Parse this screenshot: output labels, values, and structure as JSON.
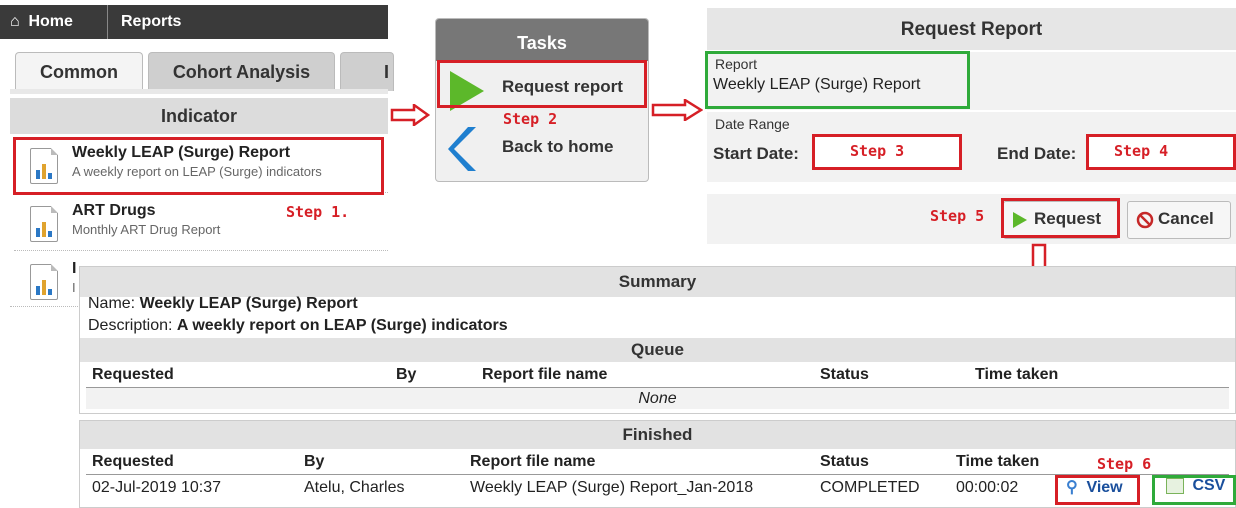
{
  "nav": {
    "home": "Home",
    "reports": "Reports"
  },
  "tabs": [
    "Common",
    "Cohort Analysis",
    "I"
  ],
  "indicator": {
    "header": "Indicator",
    "items": [
      {
        "title": "Weekly LEAP (Surge) Report",
        "desc": "A weekly report on LEAP (Surge) indicators"
      },
      {
        "title": "ART Drugs",
        "desc": "Monthly ART Drug Report"
      },
      {
        "title": "I",
        "desc": "I"
      }
    ]
  },
  "tasks": {
    "header": "Tasks",
    "request": "Request report",
    "back": "Back to home"
  },
  "request_report": {
    "header": "Request Report",
    "report_label": "Report",
    "report_value": "Weekly LEAP (Surge) Report",
    "date_range_label": "Date Range",
    "start_label": "Start Date:",
    "end_label": "End Date:",
    "request_btn": "Request",
    "cancel_btn": "Cancel"
  },
  "steps": {
    "s1": "Step 1.",
    "s2": "Step 2",
    "s3": "Step 3",
    "s4": "Step 4",
    "s5": "Step 5",
    "s6": "Step 6"
  },
  "summary": {
    "header": "Summary",
    "name_label": "Name: ",
    "name_value": "Weekly LEAP (Surge) Report",
    "desc_label": "Description: ",
    "desc_value": "A weekly report on LEAP (Surge) indicators",
    "queue_header": "Queue",
    "columns": [
      "Requested",
      "By",
      "Report file name",
      "Status",
      "Time taken"
    ],
    "queue_empty": "None"
  },
  "finished": {
    "header": "Finished",
    "columns": [
      "Requested",
      "By",
      "Report file name",
      "Status",
      "Time taken"
    ],
    "row": {
      "requested": "02-Jul-2019 10:37",
      "by": "Atelu, Charles",
      "file": "Weekly LEAP (Surge) Report_Jan-2018",
      "status": "COMPLETED",
      "time": "00:00:02"
    },
    "view": "View",
    "csv": "CSV"
  },
  "colors": {
    "annotation_red": "#d61f26",
    "annotation_green": "#2faa3a",
    "play_green": "#5cb82a",
    "back_blue": "#1f7fcf"
  }
}
